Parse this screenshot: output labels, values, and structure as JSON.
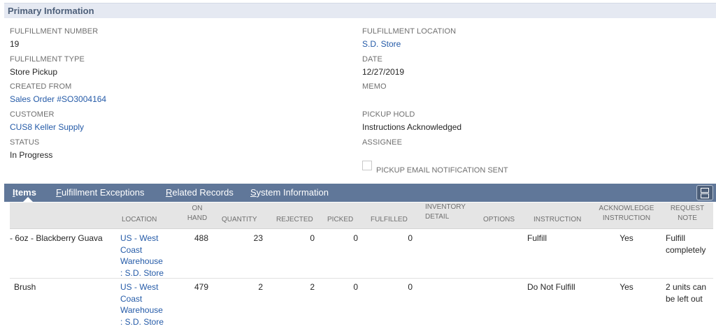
{
  "section": {
    "title": "Primary Information"
  },
  "fields": {
    "fulfillment_number": {
      "label": "FULFILLMENT NUMBER",
      "value": "19"
    },
    "fulfillment_type": {
      "label": "FULFILLMENT TYPE",
      "value": "Store Pickup"
    },
    "created_from": {
      "label": "CREATED FROM",
      "value": "Sales Order #SO3004164"
    },
    "customer": {
      "label": "CUSTOMER",
      "value": "CUS8 Keller Supply"
    },
    "status": {
      "label": "STATUS",
      "value": "In Progress"
    },
    "fulfillment_location": {
      "label": "FULFILLMENT LOCATION",
      "value": "S.D. Store"
    },
    "date": {
      "label": "DATE",
      "value": "12/27/2019"
    },
    "memo": {
      "label": "MEMO",
      "value": ""
    },
    "pickup_hold": {
      "label": "PICKUP HOLD",
      "value": "Instructions Acknowledged"
    },
    "assignee": {
      "label": "ASSIGNEE",
      "value": ""
    },
    "pickup_email": {
      "label": "PICKUP EMAIL NOTIFICATION SENT",
      "checked": false
    }
  },
  "tabs": [
    {
      "first": "I",
      "rest": "tems",
      "active": true
    },
    {
      "first": "F",
      "rest": "ulfillment Exceptions",
      "active": false
    },
    {
      "first": "R",
      "rest": "elated Records",
      "active": false
    },
    {
      "first": "S",
      "rest": "ystem Information",
      "active": false
    }
  ],
  "table": {
    "columns": {
      "location": "LOCATION",
      "on_hand_1": "ON",
      "on_hand_2": "HAND",
      "quantity": "QUANTITY",
      "rejected": "REJECTED",
      "picked": "PICKED",
      "fulfilled": "FULFILLED",
      "inventory_1": "INVENTORY",
      "inventory_2": "DETAIL",
      "options": "OPTIONS",
      "instruction": "INSTRUCTION",
      "acknowledge_1": "ACKNOWLEDGE",
      "acknowledge_2": "INSTRUCTION",
      "request_1": "REQUEST",
      "request_2": "NOTE"
    },
    "rows": [
      {
        "item": "- 6oz - Blackberry Guava",
        "location_lines": [
          "US - West",
          "Coast",
          "Warehouse",
          ": S.D. Store"
        ],
        "on_hand": "488",
        "quantity": "23",
        "rejected": "0",
        "picked": "0",
        "fulfilled": "0",
        "instruction": "Fulfill",
        "acknowledge": "Yes",
        "note_lines": [
          "Fulfill",
          "completely"
        ]
      },
      {
        "item": "Brush",
        "location_lines": [
          "US - West",
          "Coast",
          "Warehouse",
          ": S.D. Store"
        ],
        "on_hand": "479",
        "quantity": "2",
        "rejected": "2",
        "picked": "0",
        "fulfilled": "0",
        "instruction": "Do Not Fulfill",
        "acknowledge": "Yes",
        "note_lines": [
          "2 units can",
          "be left out"
        ]
      }
    ]
  },
  "colors": {
    "header_bg": "#e5e9f2",
    "tabbar_bg": "#607799",
    "link": "#255ba8"
  },
  "icons": {
    "layout_toggle": "two-rows-layout-icon"
  }
}
